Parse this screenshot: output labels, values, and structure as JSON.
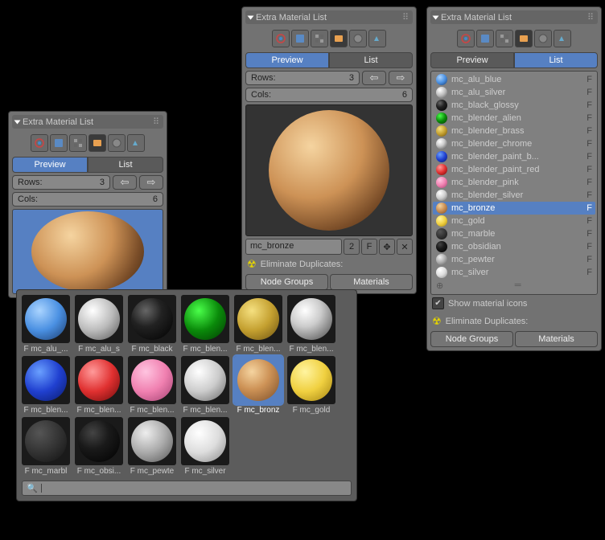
{
  "title": "Extra Material List",
  "tabs": {
    "preview": "Preview",
    "list": "List"
  },
  "rows": {
    "label": "Rows:",
    "value": "3"
  },
  "cols": {
    "label": "Cols:",
    "value": "6"
  },
  "material": {
    "name": "mc_bronze",
    "users": "2",
    "flag": "F"
  },
  "elim": "Eliminate Duplicates:",
  "btns": {
    "ng": "Node Groups",
    "mat": "Materials"
  },
  "showIcons": "Show material icons",
  "list": [
    {
      "n": "mc_alu_blue",
      "c": "radial-gradient(circle at 35% 30%,#aad4ff,#4a90e2 50%,#1a3a6a)"
    },
    {
      "n": "mc_alu_silver",
      "c": "radial-gradient(circle at 35% 30%,#fff,#bbb 50%,#555)"
    },
    {
      "n": "mc_black_glossy",
      "c": "radial-gradient(circle at 35% 30%,#666,#222 40%,#000)"
    },
    {
      "n": "mc_blender_alien",
      "c": "radial-gradient(circle at 35% 30%,#4aff4a,#0a8a0a 50%,#033a03)"
    },
    {
      "n": "mc_blender_brass",
      "c": "radial-gradient(circle at 35% 30%,#f5e080,#c4a030 50%,#6a5010)"
    },
    {
      "n": "mc_blender_chrome",
      "c": "radial-gradient(circle at 35% 30%,#fff,#ccc 40%,#444)"
    },
    {
      "n": "mc_blender_paint_b...",
      "c": "radial-gradient(circle at 35% 30%,#6aa0ff,#2040d0 50%,#0a1a6a)"
    },
    {
      "n": "mc_blender_paint_red",
      "c": "radial-gradient(circle at 35% 30%,#ff9a9a,#e03030 50%,#6a0a0a)"
    },
    {
      "n": "mc_blender_pink",
      "c": "radial-gradient(circle at 35% 30%,#ffc4e0,#f080b0 50%,#a04070)"
    },
    {
      "n": "mc_blender_silver",
      "c": "radial-gradient(circle at 35% 30%,#fff,#ccc 50%,#666)"
    },
    {
      "n": "mc_bronze",
      "c": "radial-gradient(circle at 35% 30%,#f5d4a0,#cd9256 45%,#7a4d28)",
      "sel": true
    },
    {
      "n": "mc_gold",
      "c": "radial-gradient(circle at 35% 30%,#fff4a0,#f0d040 50%,#a08010)"
    },
    {
      "n": "mc_marble",
      "c": "radial-gradient(circle at 35% 30%,#555,#333 50%,#111)"
    },
    {
      "n": "mc_obsidian",
      "c": "radial-gradient(circle at 35% 30%,#444,#1a1a1a 40%,#000)"
    },
    {
      "n": "mc_pewter",
      "c": "radial-gradient(circle at 35% 30%,#eee,#aaa 50%,#555)"
    },
    {
      "n": "mc_silver",
      "c": "radial-gradient(circle at 35% 30%,#fff,#ddd 50%,#888)"
    }
  ],
  "grid": [
    [
      {
        "l": "F mc_alu_...",
        "c": "radial-gradient(circle at 35% 30%,#aad4ff,#4a90e2 50%,#1a3a6a)"
      },
      {
        "l": "F mc_alu_s",
        "c": "radial-gradient(circle at 35% 30%,#fff,#bbb 50%,#555)"
      },
      {
        "l": "F mc_black",
        "c": "radial-gradient(circle at 35% 30%,#666,#222 40%,#000)"
      },
      {
        "l": "F mc_blen...",
        "c": "radial-gradient(circle at 35% 30%,#4aff4a,#0a8a0a 50%,#033a03)"
      },
      {
        "l": "F mc_blen...",
        "c": "radial-gradient(circle at 35% 30%,#f5e080,#c4a030 50%,#6a5010)"
      },
      {
        "l": "F mc_blen...",
        "c": "radial-gradient(circle at 35% 30%,#fff,#ccc 40%,#444)"
      }
    ],
    [
      {
        "l": "F mc_blen...",
        "c": "radial-gradient(circle at 35% 30%,#6aa0ff,#2040d0 50%,#0a1a6a)"
      },
      {
        "l": "F mc_blen...",
        "c": "radial-gradient(circle at 35% 30%,#ff9a9a,#e03030 50%,#6a0a0a)"
      },
      {
        "l": "F mc_blen...",
        "c": "radial-gradient(circle at 35% 30%,#ffc4e0,#f080b0 50%,#a04070)"
      },
      {
        "l": "F mc_blen...",
        "c": "radial-gradient(circle at 35% 30%,#fff,#ccc 50%,#666)"
      },
      {
        "l": "F mc_bronz",
        "c": "radial-gradient(circle at 35% 30%,#f5d4a0,#cd9256 45%,#7a4d28)",
        "sel": true
      },
      {
        "l": "F mc_gold",
        "c": "radial-gradient(circle at 35% 30%,#fff4a0,#f0d040 50%,#a08010)"
      }
    ],
    [
      {
        "l": "F mc_marbl",
        "c": "radial-gradient(circle at 35% 30%,#555,#333 50%,#111)"
      },
      {
        "l": "F mc_obsi...",
        "c": "radial-gradient(circle at 35% 30%,#444,#1a1a1a 40%,#000)"
      },
      {
        "l": "F mc_pewte",
        "c": "radial-gradient(circle at 35% 30%,#eee,#aaa 50%,#555)"
      },
      {
        "l": "F mc_silver",
        "c": "radial-gradient(circle at 35% 30%,#fff,#ddd 50%,#888)"
      }
    ]
  ]
}
